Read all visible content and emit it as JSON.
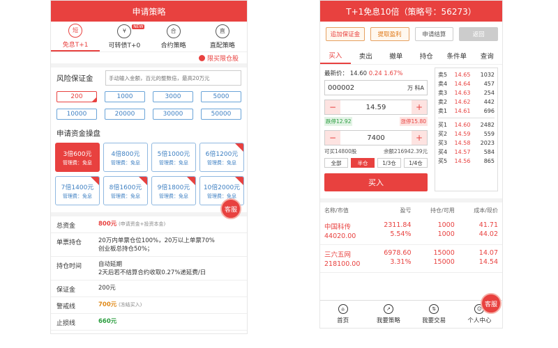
{
  "left": {
    "title": "申请策略",
    "nav": [
      {
        "label": "免息T+1",
        "icon_text": "短"
      },
      {
        "label": "可转债T+0",
        "icon_text": "¥"
      },
      {
        "label": "合约策略",
        "icon_text": "合"
      },
      {
        "label": "直配策略",
        "icon_text": "直"
      }
    ],
    "new_badge": "NEW",
    "limit_link": "限买限仓股",
    "margin_label": "风险保证金",
    "margin_placeholder": "手动输入金额，百元的整数倍，最高20万元",
    "amounts": [
      "200",
      "1000",
      "3000",
      "5000",
      "10000",
      "20000",
      "30000",
      "50000"
    ],
    "apply_title": "申请资金操盘",
    "multiples": [
      {
        "main": "3倍600元",
        "sub": "管理费：免息"
      },
      {
        "main": "4倍800元",
        "sub": "管理费：免息"
      },
      {
        "main": "5倍1000元",
        "sub": "管理费：免息"
      },
      {
        "main": "6倍1200元",
        "sub": "管理费：免息"
      },
      {
        "main": "7倍1400元",
        "sub": "管理费：免息"
      },
      {
        "main": "8倍1600元",
        "sub": "管理费：免息"
      },
      {
        "main": "9倍1800元",
        "sub": "管理费：免息"
      },
      {
        "main": "10倍2000元",
        "sub": "管理费：免息"
      }
    ],
    "info": {
      "total_k": "总资金",
      "total_v": "800元",
      "total_note": "(申请资金+投资本金)",
      "single_k": "单票持仓",
      "single_v1": "20万内单票仓位100%，20万以上单票70%",
      "single_v2": "创业板总持仓50%；",
      "hold_k": "持仓时间",
      "hold_v1": "自动延期",
      "hold_v2": "2天后若不结算合约收取0.27%递延费/日",
      "deposit_k": "保证金",
      "deposit_v": "200元",
      "warn_k": "警戒线",
      "warn_v": "700元",
      "warn_note": "(冻结买入)",
      "stop_k": "止损线",
      "stop_v": "660元"
    },
    "float_text": "客服"
  },
  "right": {
    "title": "T+1免息10倍（策略号：56273）",
    "buttons": [
      "追加保证金",
      "提取盈利",
      "申请结算",
      "返回"
    ],
    "tabs": [
      "买入",
      "卖出",
      "撤单",
      "持仓",
      "条件单",
      "查询"
    ],
    "latest_label": "最新价：",
    "latest_price": "14.60",
    "latest_change": "0.24",
    "latest_pct": "1.67%",
    "stock_code": "000002",
    "stock_name": "万 科A",
    "price": "14.59",
    "limit_down": "跌停12.92",
    "limit_up": "涨停15.80",
    "qty": "7400",
    "can_buy": "可买14800股",
    "balance": "余额216942.39元",
    "portions": [
      "全部",
      "半仓",
      "1/3仓",
      "1/4仓"
    ],
    "buy_label": "买入",
    "asks": [
      {
        "l": "卖5",
        "p": "14.65",
        "q": "1032"
      },
      {
        "l": "卖4",
        "p": "14.64",
        "q": "457"
      },
      {
        "l": "卖3",
        "p": "14.63",
        "q": "254"
      },
      {
        "l": "卖2",
        "p": "14.62",
        "q": "442"
      },
      {
        "l": "卖1",
        "p": "14.61",
        "q": "696"
      }
    ],
    "bids": [
      {
        "l": "买1",
        "p": "14.60",
        "q": "2482"
      },
      {
        "l": "买2",
        "p": "14.59",
        "q": "559"
      },
      {
        "l": "买3",
        "p": "14.58",
        "q": "2023"
      },
      {
        "l": "买4",
        "p": "14.57",
        "q": "584"
      },
      {
        "l": "买5",
        "p": "14.56",
        "q": "865"
      }
    ],
    "pos_headers": [
      "名称/市值",
      "盈亏",
      "持仓/可用",
      "成本/现价"
    ],
    "positions": [
      {
        "name": "中国科传",
        "value": "44020.00",
        "pl": "2311.84",
        "plp": "5.54%",
        "hold": "1000",
        "avail": "1000",
        "cost": "41.71",
        "now": "44.02"
      },
      {
        "name": "三六五网",
        "value": "218100.00",
        "pl": "6978.60",
        "plp": "3.31%",
        "hold": "15000",
        "avail": "15000",
        "cost": "14.07",
        "now": "14.54"
      }
    ],
    "bottom_nav": [
      "首页",
      "我要策略",
      "我要交易",
      "个人中心"
    ]
  }
}
